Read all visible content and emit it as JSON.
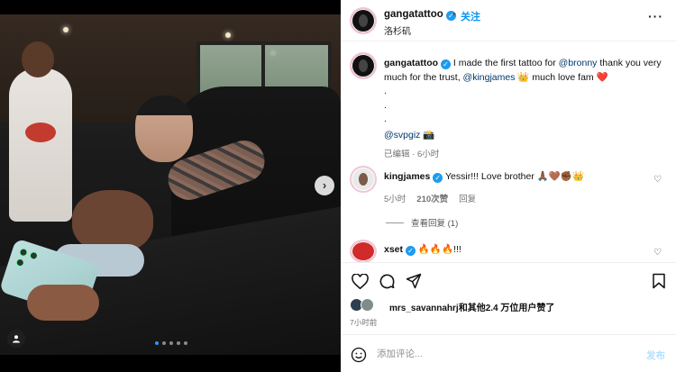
{
  "post": {
    "dots_count": 5,
    "active_dot": 0
  },
  "header": {
    "username": "gangatattoo",
    "separator": "•",
    "follow_label": "关注",
    "location": "洛杉矶",
    "more_label": "···"
  },
  "caption": {
    "username": "gangatattoo",
    "text_1": "I made the first tattoo for",
    "mention_1": "@bronny",
    "text_2": "thank you very much for the trust,",
    "mention_2": "@kingjames",
    "emoji_1": "👑",
    "text_3": "much love fam",
    "emoji_2": "❤️",
    "dot_lines": [
      ".",
      ".",
      "."
    ],
    "mention_3": "@svpgiz",
    "emoji_3": "📸",
    "meta": "已编辑 · 6小时"
  },
  "comments": [
    {
      "username": "kingjames",
      "text": "Yessir!!! Love brother 🙏🏾🤎✊🏾👑",
      "time": "5小时",
      "likes": "210次赞",
      "reply_label": "回复"
    },
    {
      "username": "xset",
      "text": "🔥🔥🔥!!!"
    }
  ],
  "view_replies_label": "查看回复 (1)",
  "likes": {
    "text": "mrs_savannahrj和其他2.4 万位用户赞了"
  },
  "post_time": "7小时前",
  "add_comment": {
    "placeholder": "添加评论...",
    "post_label": "发布"
  },
  "colors": {
    "accent": "#0095f6",
    "verified": "#1d9bf0",
    "link": "#00376b",
    "muted": "#737373"
  }
}
